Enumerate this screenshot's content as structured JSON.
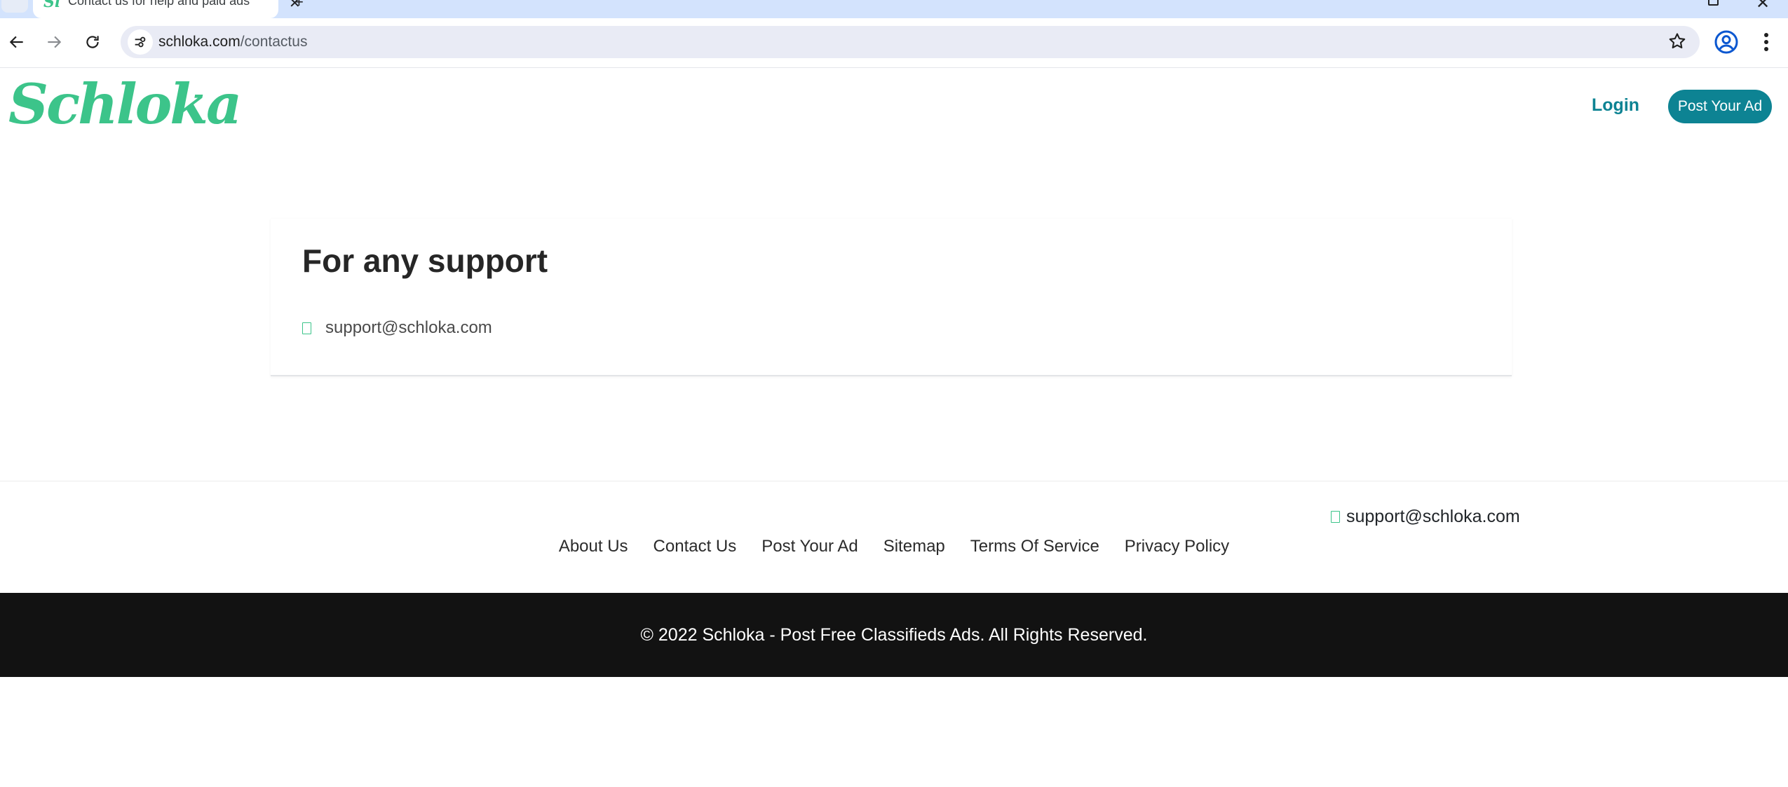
{
  "browser": {
    "tab_favicon": "Sl",
    "tab_title": "Contact us for help and paid ads",
    "url_domain": "schloka.com",
    "url_path": "/contactus",
    "icons": [
      "back-icon",
      "forward-icon",
      "reload-icon",
      "site-info-icon",
      "star-icon",
      "profile-icon",
      "menu-icon"
    ]
  },
  "header": {
    "logo_text": "Schloka",
    "login_label": "Login",
    "post_ad_label": "Post Your Ad"
  },
  "support": {
    "title": "For any support",
    "email": "support@schloka.com"
  },
  "footer": {
    "email": "support@schloka.com",
    "links": [
      "About Us",
      "Contact Us",
      "Post Your Ad",
      "Sitemap",
      "Terms Of Service",
      "Privacy Policy"
    ],
    "copyright": "© 2022 Schloka - Post Free Classifieds Ads. All Rights Reserved."
  },
  "colors": {
    "brand_green": "#3cc48a",
    "accent_teal": "#0d8393",
    "footer_dark": "#121212"
  }
}
